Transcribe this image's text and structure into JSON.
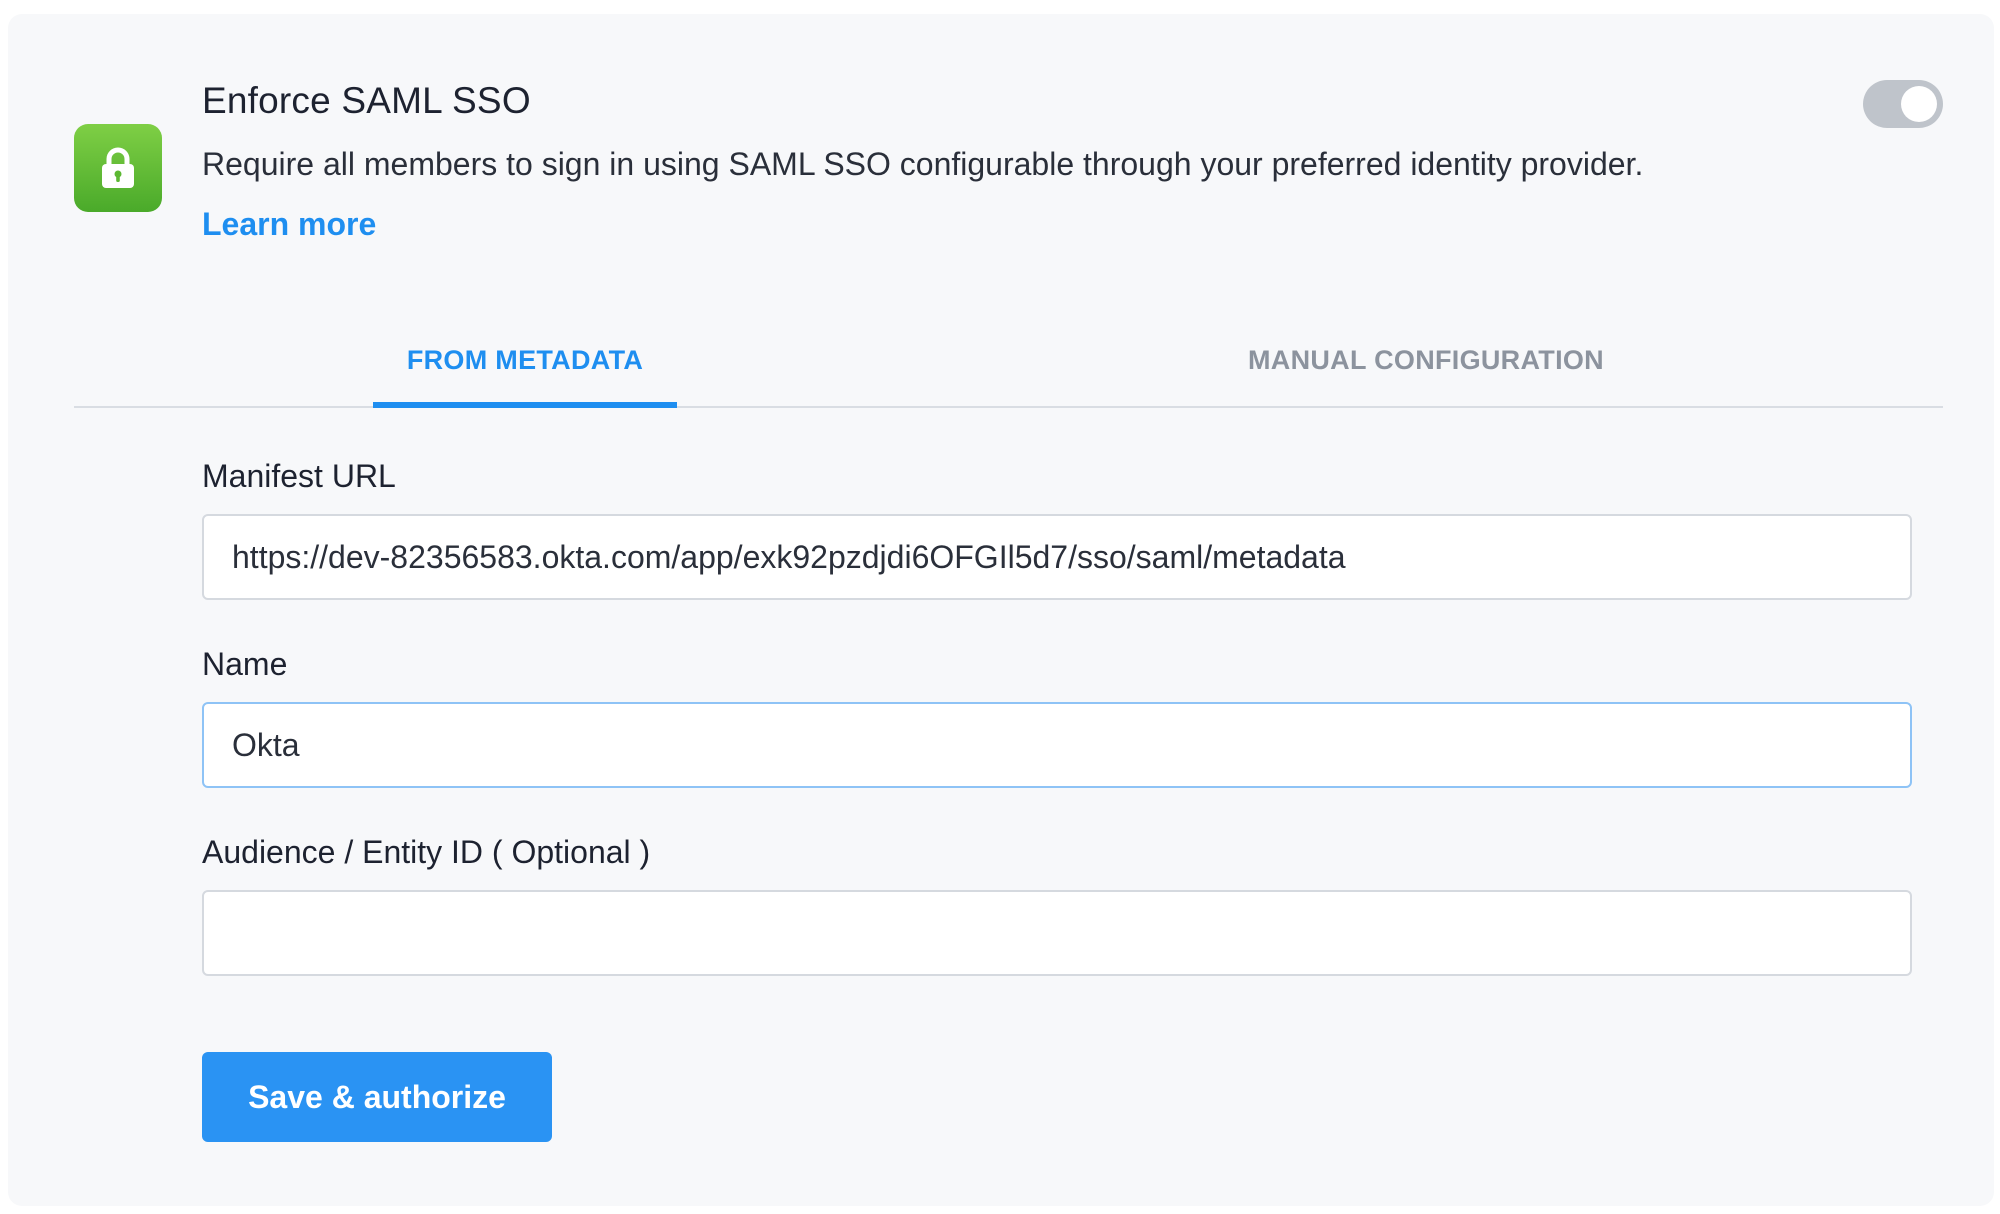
{
  "header": {
    "title": "Enforce SAML SSO",
    "description": "Require all members to sign in using SAML SSO configurable through your preferred identity provider.",
    "learn_more": "Learn more",
    "icon": "lock-icon",
    "toggle_on": false
  },
  "tabs": [
    {
      "label": "FROM METADATA",
      "active": true
    },
    {
      "label": "MANUAL CONFIGURATION",
      "active": false
    }
  ],
  "form": {
    "manifest_url": {
      "label": "Manifest URL",
      "value": "https://dev-82356583.okta.com/app/exk92pzdjdi6OFGIl5d7/sso/saml/metadata"
    },
    "name": {
      "label": "Name",
      "value": "Okta"
    },
    "audience": {
      "label": "Audience / Entity ID ( Optional )",
      "value": ""
    },
    "submit_label": "Save & authorize"
  },
  "colors": {
    "accent": "#1e8ef0",
    "icon_green": "#5cb833",
    "toggle_off": "#bfc4cb"
  }
}
